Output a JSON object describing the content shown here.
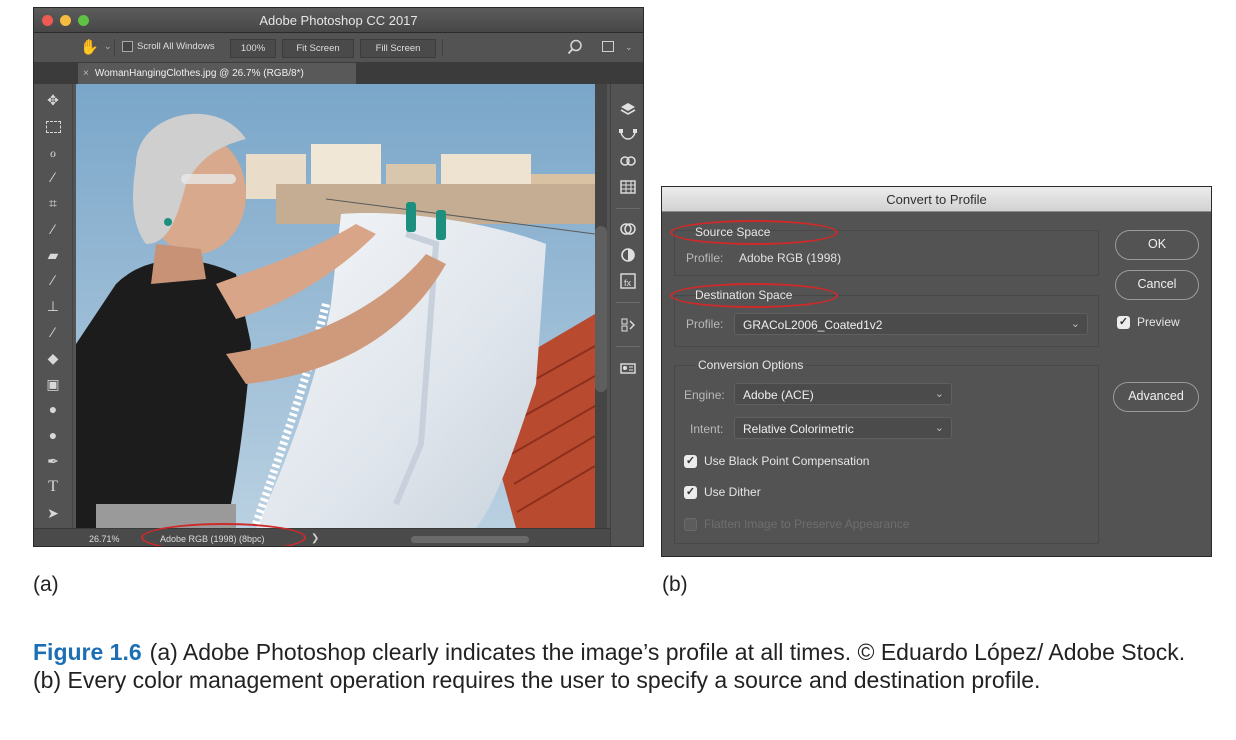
{
  "photoshop": {
    "app_title": "Adobe Photoshop CC 2017",
    "options_bar": {
      "scroll_all_windows": "Scroll All Windows",
      "zoom_100": "100%",
      "fit_screen": "Fit Screen",
      "fill_screen": "Fill Screen"
    },
    "document_tab": "WomanHangingClothes.jpg @ 26.7% (RGB/8*)",
    "tools": [
      "move-icon",
      "marquee-icon",
      "lasso-icon",
      "magic-wand-icon",
      "crop-icon",
      "eyedropper-icon",
      "healing-brush-icon",
      "brush-icon",
      "clone-stamp-icon",
      "history-brush-icon",
      "eraser-icon",
      "gradient-icon",
      "blur-icon",
      "dodge-icon",
      "pen-icon",
      "type-icon",
      "path-selection-icon"
    ],
    "status_bar": {
      "zoom": "26.71%",
      "profile": "Adobe RGB (1998) (8bpc)",
      "arrow": "❯"
    }
  },
  "dialog": {
    "title": "Convert to Profile",
    "source_space": {
      "legend": "Source Space",
      "profile_label": "Profile:",
      "profile_value": "Adobe RGB (1998)"
    },
    "destination_space": {
      "legend": "Destination Space",
      "profile_label": "Profile:",
      "profile_value": "GRACoL2006_Coated1v2"
    },
    "conversion_options": {
      "legend": "Conversion Options",
      "engine_label": "Engine:",
      "engine_value": "Adobe (ACE)",
      "intent_label": "Intent:",
      "intent_value": "Relative Colorimetric",
      "black_point": "Use Black Point Compensation",
      "black_point_checked": true,
      "dither": "Use Dither",
      "dither_checked": true,
      "flatten": "Flatten Image to Preserve Appearance",
      "flatten_checked": false
    },
    "buttons": {
      "ok": "OK",
      "cancel": "Cancel",
      "preview": "Preview",
      "preview_checked": true,
      "advanced": "Advanced"
    }
  },
  "labels": {
    "a": "(a)",
    "b": "(b)"
  },
  "caption": {
    "label": "Figure 1.6",
    "text": "(a) Adobe Photoshop clearly indicates the image’s profile at all times. © Eduardo López/ Adobe Stock. (b) Every color management operation requires the user to specify a source and destination profile."
  },
  "colors": {
    "highlight_ring": "#cf2a2a",
    "figure_label": "#1c6fb5",
    "panel_bg": "#535353"
  }
}
